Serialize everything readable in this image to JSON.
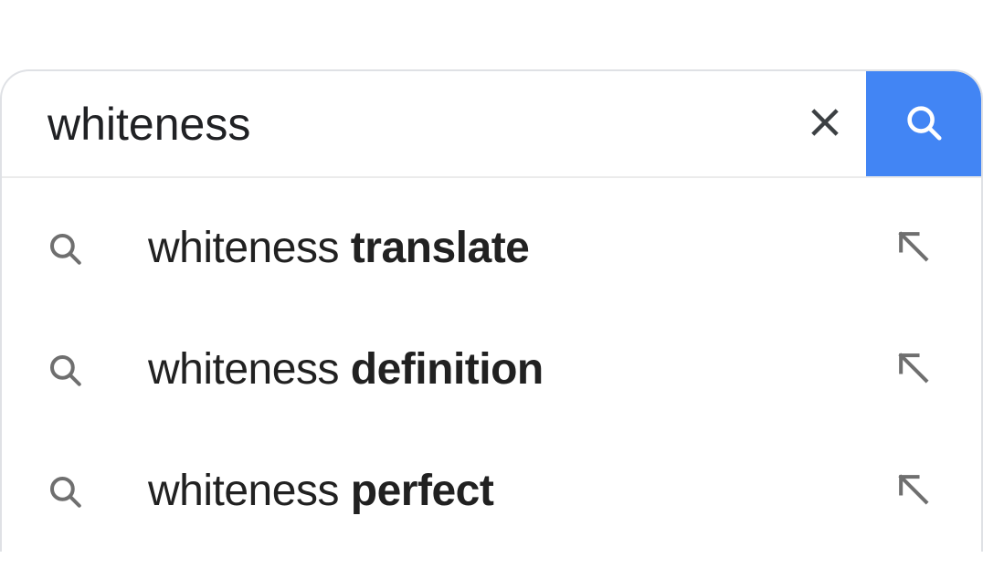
{
  "search": {
    "query": "whiteness",
    "placeholder": ""
  },
  "suggestions": [
    {
      "prefix": "whiteness ",
      "completion": "translate"
    },
    {
      "prefix": "whiteness ",
      "completion": "definition"
    },
    {
      "prefix": "whiteness ",
      "completion": "perfect"
    }
  ],
  "icons": {
    "clear": "close-icon",
    "search": "search-icon",
    "suggestionSearch": "search-icon",
    "fillArrow": "arrow-up-left-icon"
  },
  "colors": {
    "searchButton": "#4285f4",
    "iconGray": "#70757a",
    "textDark": "#202124"
  }
}
